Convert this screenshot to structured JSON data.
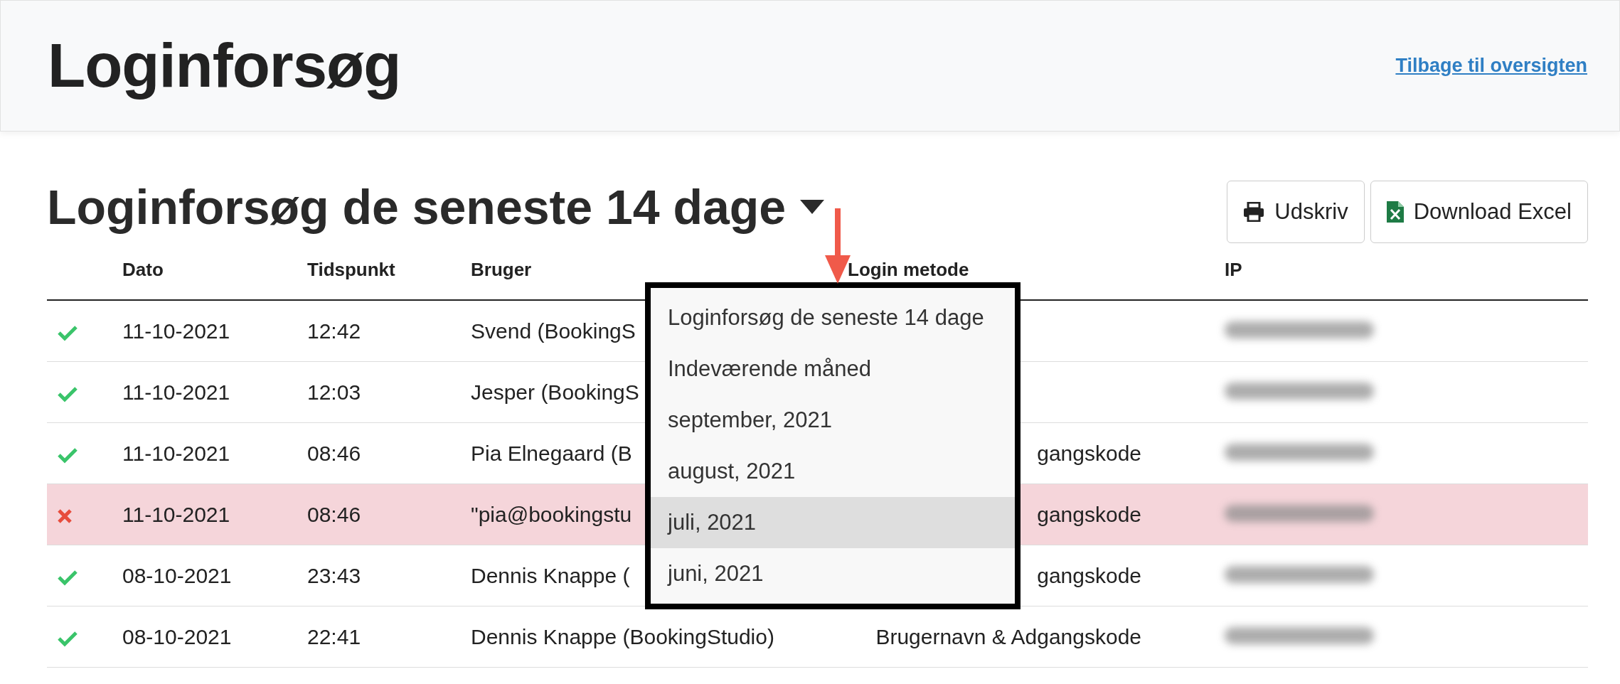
{
  "page": {
    "title": "Loginforsøg",
    "back_link": "Tilbage til oversigten"
  },
  "section": {
    "title": "Loginforsøg de seneste 14 dage",
    "buttons": [
      {
        "label": "Udskriv",
        "kind": "print"
      },
      {
        "label": "Download Excel",
        "kind": "excel"
      }
    ]
  },
  "table": {
    "columns": [
      "Dato",
      "Tidspunkt",
      "Bruger",
      "Login metode",
      "IP"
    ],
    "rows": [
      {
        "success": true,
        "date": "11-10-2021",
        "time": "12:42",
        "user": "Svend (BookingS"
      },
      {
        "success": true,
        "date": "11-10-2021",
        "time": "12:03",
        "user": "Jesper (BookingS"
      },
      {
        "success": true,
        "date": "11-10-2021",
        "time": "08:46",
        "user": "Pia Elnegaard (B",
        "method": "gangskode"
      },
      {
        "success": false,
        "date": "11-10-2021",
        "time": "08:46",
        "user": "\"pia@bookingstu",
        "method": "gangskode"
      },
      {
        "success": true,
        "date": "08-10-2021",
        "time": "23:43",
        "user": "Dennis Knappe (",
        "method": "gangskode"
      },
      {
        "success": true,
        "date": "08-10-2021",
        "time": "22:41",
        "user": "Dennis Knappe (BookingStudio)",
        "method": "Brugernavn & Adgangskode"
      }
    ]
  },
  "period_menu": {
    "items": [
      {
        "label": "Loginforsøg de seneste 14 dage",
        "selected": false
      },
      {
        "label": "Indeværende måned",
        "selected": false
      },
      {
        "label": "september, 2021",
        "selected": false
      },
      {
        "label": "august, 2021",
        "selected": false
      },
      {
        "label": "juli, 2021",
        "selected": true
      },
      {
        "label": "juni, 2021",
        "selected": false
      }
    ]
  }
}
